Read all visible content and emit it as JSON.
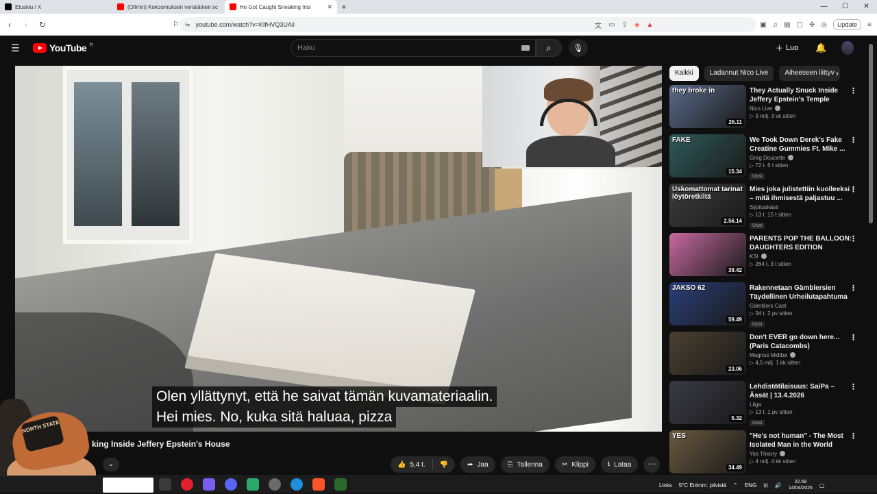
{
  "browser": {
    "tabs": [
      {
        "label": "Etusivu / X",
        "active": false,
        "favicon_color": "#000000"
      },
      {
        "label": "(Ollmiri) Kokoomuksen venäläinen sc",
        "active": false,
        "favicon_color": "#ff0000"
      },
      {
        "label": "He Got Caught Sneaking Insi",
        "active": true,
        "favicon_color": "#ff0000"
      }
    ],
    "new_tab": "+",
    "url": "youtube.com/watch?v=KIfHVQ3UAil",
    "update_label": "Update",
    "window_controls": [
      "—",
      "☐",
      "✕"
    ]
  },
  "masthead": {
    "logo_text": "YouTube",
    "region": "FI",
    "search_placeholder": "Haku",
    "create_label": "Luo"
  },
  "player": {
    "subtitles": [
      "Olen yllättynyt, että he saivat tämän kuvamateriaalin.",
      "Hei mies.  No, kuka sitä haluaa, pizza"
    ],
    "title": "king Inside Jeffery Epstein's House",
    "facecam_badge": "NORTH STATE"
  },
  "actions": {
    "like_count": "5,4 t.",
    "share": "Jaa",
    "save": "Tallenna",
    "clip": "Klippi",
    "download": "Lataa"
  },
  "chips": [
    "Kaikki",
    "Ladannut Nico Live",
    "Aiheeseen liittyv"
  ],
  "recommendations": [
    {
      "title": "They Actually Snuck Inside Jeffery Epstein's Temple",
      "channel": "Nico Live",
      "verified": true,
      "meta": "▷ 3 milj.  3 vk sitten",
      "duration": "26.11",
      "thumb_text": "they broke in",
      "new": false,
      "thumb_color": "#5a6a8a"
    },
    {
      "title": "We Took Down Derek's Fake Creatine Gummies Ft. Mike ...",
      "channel": "Greg Doucette",
      "verified": true,
      "meta": "▷ 72 t.  6 t sitten",
      "duration": "15.34",
      "thumb_text": "FAKE",
      "new": true,
      "thumb_color": "#2f5a5a"
    },
    {
      "title": "Mies joka julistettiin kuolleeksi – mitä ihmisestä paljastuu ...",
      "channel": "Sijoituskästi",
      "verified": false,
      "meta": "▷ 13 t.  15 t sitten",
      "duration": "2.56.14",
      "thumb_text": "Uskomattomat tarinat löytöretkiltä",
      "new": true,
      "thumb_color": "#3c3c3c"
    },
    {
      "title": "PARENTS POP THE BALLOON: DAUGHTERS EDITION",
      "channel": "KSI",
      "verified": true,
      "meta": "▷ 264 t.  3 t sitten",
      "duration": "39.42",
      "thumb_text": "",
      "new": false,
      "thumb_color": "#c86aa0"
    },
    {
      "title": "Rakennetaan Gämblersien Täydellinen Urheilutapahtuma",
      "channel": "Gämblers Cast",
      "verified": false,
      "meta": "▷ 34 t.  2 pv sitten",
      "duration": "59.49",
      "thumb_text": "JAKSO 62",
      "new": true,
      "thumb_color": "#2a3f7a"
    },
    {
      "title": "Don't EVER go down here... (Paris Catacombs)",
      "channel": "Magnus Midtbø",
      "verified": true,
      "meta": "▷ 4,5 milj.  1 kk sitten",
      "duration": "23.06",
      "thumb_text": "",
      "new": false,
      "thumb_color": "#4a4030"
    },
    {
      "title": "Lehdistötilaisuus: SaiPa – Ässät | 13.4.2026",
      "channel": "Liiga",
      "verified": false,
      "meta": "▷ 13 t.  1 pv sitten",
      "duration": "5.32",
      "thumb_text": "",
      "new": true,
      "thumb_color": "#3a3a44"
    },
    {
      "title": "\"He's not human\" - The Most Isolated Man in the World",
      "channel": "Yes Theory",
      "verified": true,
      "meta": "▷ 4 milj.  4 kk sitten",
      "duration": "34.49",
      "thumb_text": "YES",
      "new": false,
      "thumb_color": "#6a5a40"
    }
  ],
  "taskbar": {
    "links": "Links",
    "weather": "5°C  Enimm. pilvistä",
    "lang": "ENG",
    "time": "22.59",
    "date": "14/04/2026"
  }
}
